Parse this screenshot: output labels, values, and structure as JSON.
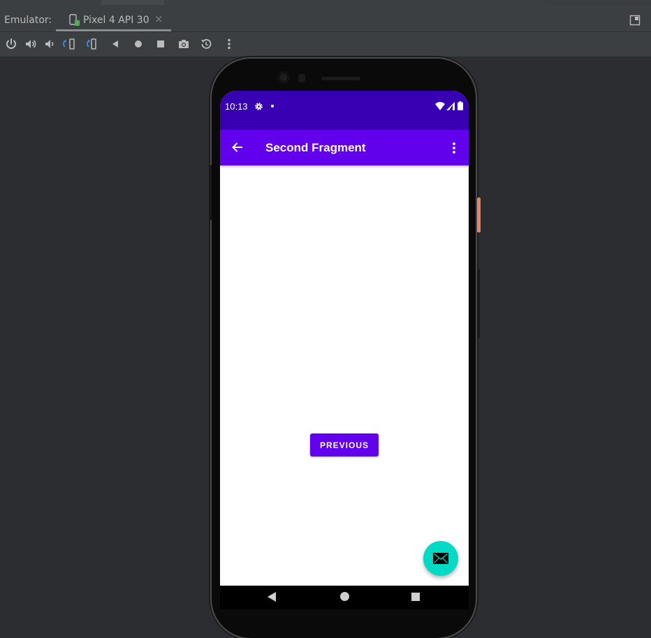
{
  "panel": {
    "label": "Emulator:",
    "device_tab": "Pixel 4 API 30",
    "tab_close": "×"
  },
  "toolbar": {
    "buttons": [
      {
        "name": "power-icon"
      },
      {
        "name": "volume-up-icon"
      },
      {
        "name": "volume-down-icon"
      },
      {
        "name": "rotate-left-icon"
      },
      {
        "name": "rotate-right-icon"
      },
      {
        "name": "back-icon"
      },
      {
        "name": "home-icon"
      },
      {
        "name": "overview-icon"
      },
      {
        "name": "screenshot-icon"
      },
      {
        "name": "snapshot-icon"
      },
      {
        "name": "more-icon"
      }
    ]
  },
  "device": {
    "status_time": "10:13",
    "app_title": "Second Fragment",
    "button_label": "PREVIOUS",
    "fab_icon": "email-icon",
    "colors": {
      "status_bar": "#3700b3",
      "app_bar": "#6200ee",
      "button": "#6200ee",
      "fab": "#03dac5"
    }
  }
}
